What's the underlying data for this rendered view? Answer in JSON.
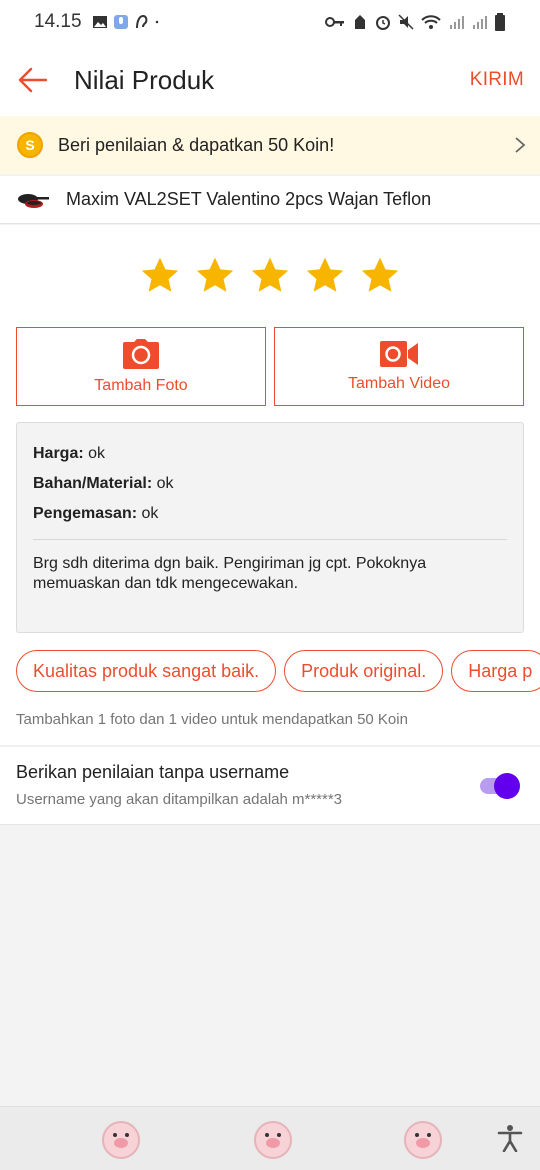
{
  "status_bar": {
    "time": "14.15"
  },
  "appbar": {
    "title": "Nilai Produk",
    "submit_label": "KIRIM"
  },
  "coin_banner": {
    "coin_symbol": "S",
    "text": "Beri penilaian & dapatkan 50 Koin!"
  },
  "product": {
    "name": "Maxim VAL2SET Valentino 2pcs Wajan Teflon"
  },
  "rating": {
    "stars": 5,
    "max": 5
  },
  "media": {
    "photo_label": "Tambah Foto",
    "video_label": "Tambah Video"
  },
  "review": {
    "price_label": "Harga:",
    "price_value": "ok",
    "material_label": "Bahan/Material:",
    "material_value": "ok",
    "packaging_label": "Pengemasan:",
    "packaging_value": "ok",
    "text": "Brg sdh diterima dgn baik. Pengiriman jg cpt. Pokoknya memuaskan dan tdk mengecewakan."
  },
  "tags": [
    "Kualitas produk sangat baik.",
    "Produk original.",
    "Harga p"
  ],
  "hint": "Tambahkan 1 foto dan 1 video untuk mendapatkan 50 Koin",
  "anonymous": {
    "title": "Berikan penilaian tanpa username",
    "subtitle": "Username yang akan ditampilkan adalah m*****3",
    "enabled": true
  },
  "colors": {
    "accent": "#ee4d2d",
    "star": "#f7b500",
    "toggle": "#6200ee",
    "banner_bg": "#fff8e3"
  }
}
